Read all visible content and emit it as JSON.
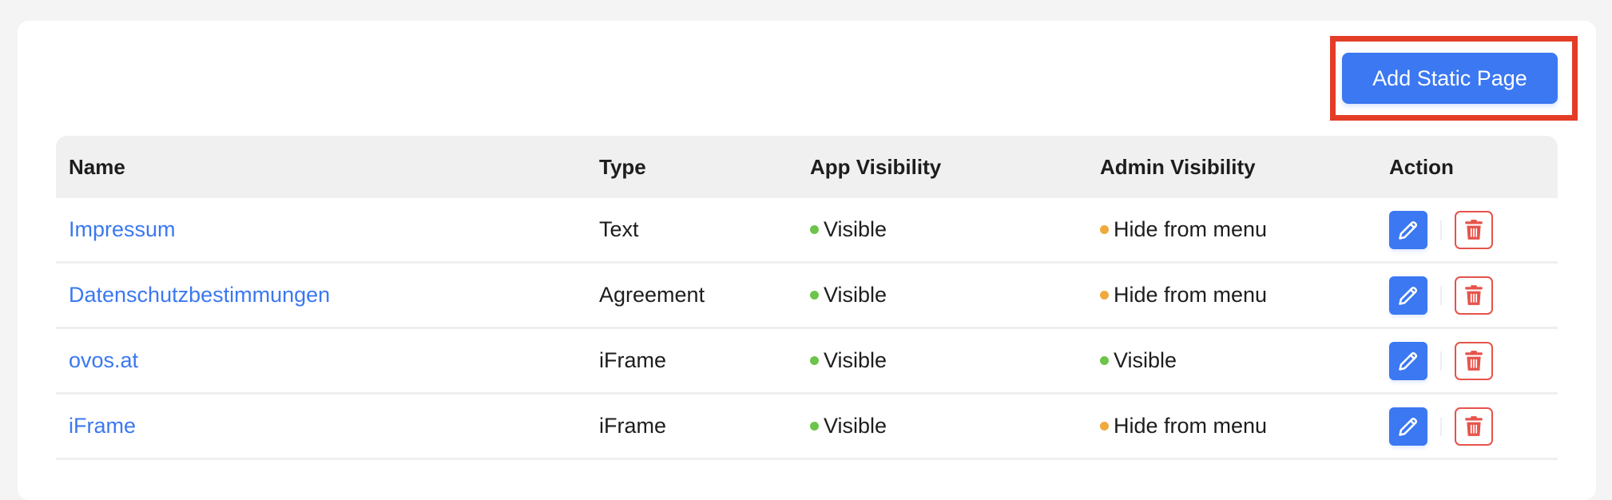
{
  "toolbar": {
    "add_label": "Add Static Page"
  },
  "colors": {
    "accent": "#3b78f1",
    "visible": "#6cc44a",
    "hidden": "#f0a93c",
    "danger": "#e6534b",
    "highlight": "#e43d27"
  },
  "table": {
    "headers": {
      "name": "Name",
      "type": "Type",
      "app": "App Visibility",
      "admin": "Admin Visibility",
      "action": "Action"
    },
    "rows": [
      {
        "name": "Impressum",
        "type": "Text",
        "app": "Visible",
        "app_status": "visible",
        "admin": "Hide from menu",
        "admin_status": "hidden"
      },
      {
        "name": "Datenschutzbestimmungen",
        "type": "Agreement",
        "app": "Visible",
        "app_status": "visible",
        "admin": "Hide from menu",
        "admin_status": "hidden"
      },
      {
        "name": "ovos.at",
        "type": "iFrame",
        "app": "Visible",
        "app_status": "visible",
        "admin": "Visible",
        "admin_status": "visible"
      },
      {
        "name": "iFrame",
        "type": "iFrame",
        "app": "Visible",
        "app_status": "visible",
        "admin": "Hide from menu",
        "admin_status": "hidden"
      }
    ],
    "row_actions": {
      "edit_icon": "pencil-icon",
      "delete_icon": "trash-icon"
    }
  }
}
